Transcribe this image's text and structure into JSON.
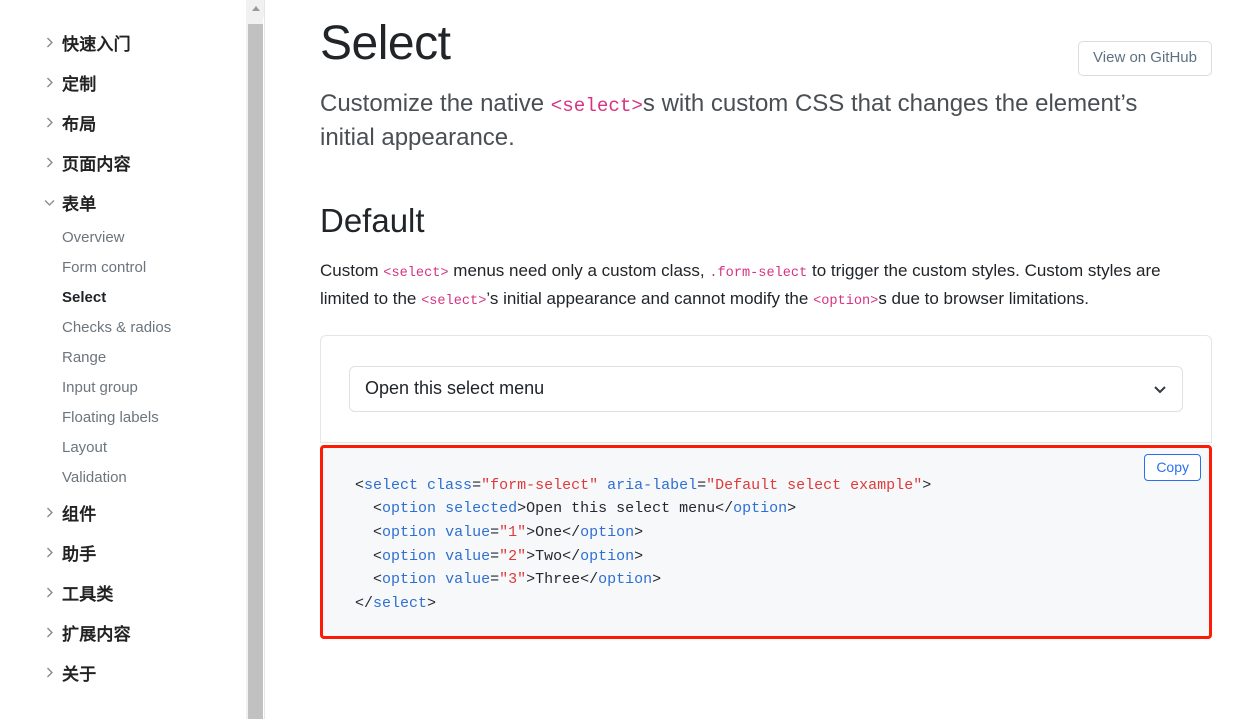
{
  "sidebar": {
    "items": [
      {
        "label": "快速入门",
        "type": "top",
        "state": "collapsed",
        "icon": "chevron-right-icon"
      },
      {
        "label": "定制",
        "type": "top",
        "state": "collapsed",
        "icon": "chevron-right-icon"
      },
      {
        "label": "布局",
        "type": "top",
        "state": "collapsed",
        "icon": "chevron-right-icon"
      },
      {
        "label": "页面内容",
        "type": "top",
        "state": "collapsed",
        "icon": "chevron-right-icon"
      },
      {
        "label": "表单",
        "type": "top",
        "state": "expanded",
        "icon": "chevron-down-icon"
      },
      {
        "label": "Overview",
        "type": "sub",
        "active": false
      },
      {
        "label": "Form control",
        "type": "sub",
        "active": false
      },
      {
        "label": "Select",
        "type": "sub",
        "active": true
      },
      {
        "label": "Checks & radios",
        "type": "sub",
        "active": false
      },
      {
        "label": "Range",
        "type": "sub",
        "active": false
      },
      {
        "label": "Input group",
        "type": "sub",
        "active": false
      },
      {
        "label": "Floating labels",
        "type": "sub",
        "active": false
      },
      {
        "label": "Layout",
        "type": "sub",
        "active": false
      },
      {
        "label": "Validation",
        "type": "sub",
        "active": false
      },
      {
        "label": "组件",
        "type": "top",
        "state": "collapsed",
        "icon": "chevron-right-icon"
      },
      {
        "label": "助手",
        "type": "top",
        "state": "collapsed",
        "icon": "chevron-right-icon"
      },
      {
        "label": "工具类",
        "type": "top",
        "state": "collapsed",
        "icon": "chevron-right-icon"
      },
      {
        "label": "扩展内容",
        "type": "top",
        "state": "collapsed",
        "icon": "chevron-right-icon"
      },
      {
        "label": "关于",
        "type": "top",
        "state": "collapsed",
        "icon": "chevron-right-icon"
      }
    ],
    "scrollbar": {
      "up_arrow_icon": "scroll-up-arrow-icon"
    }
  },
  "header": {
    "title": "Select",
    "github_button": "View on GitHub"
  },
  "lead": {
    "part1": "Customize the native ",
    "code1": "<select>",
    "part2": "s with custom CSS that changes the element’s initial appearance."
  },
  "section": {
    "heading": "Default",
    "body": {
      "p1": "Custom ",
      "c1": "<select>",
      "p2": " menus need only a custom class, ",
      "c2": ".form-select",
      "p3": " to trigger the custom styles. Custom styles are limited to the ",
      "c3": "<select>",
      "p4": "’s initial appearance and cannot modify the ",
      "c4": "<option>",
      "p5": "s due to browser limitations."
    }
  },
  "example": {
    "select_value": "Open this select menu",
    "caret_icon": "chevron-down-icon"
  },
  "code_block": {
    "copy_label": "Copy",
    "language": "html",
    "lines": [
      "<select class=\"form-select\" aria-label=\"Default select example\">",
      "  <option selected>Open this select menu</option>",
      "  <option value=\"1\">One</option>",
      "  <option value=\"2\">Two</option>",
      "  <option value=\"3\">Three</option>",
      "</select>"
    ],
    "highlight_border_color": "#fb1b06",
    "background_color": "#f6f8fa"
  },
  "colors": {
    "inline_code": "#d63384",
    "link_blue": "#2a6ff0",
    "tag_blue": "#2f6fd0",
    "attr_value_red": "#dd3b3b",
    "text": "#212529",
    "muted": "#6c757d",
    "github_btn_text": "#5d7183"
  }
}
